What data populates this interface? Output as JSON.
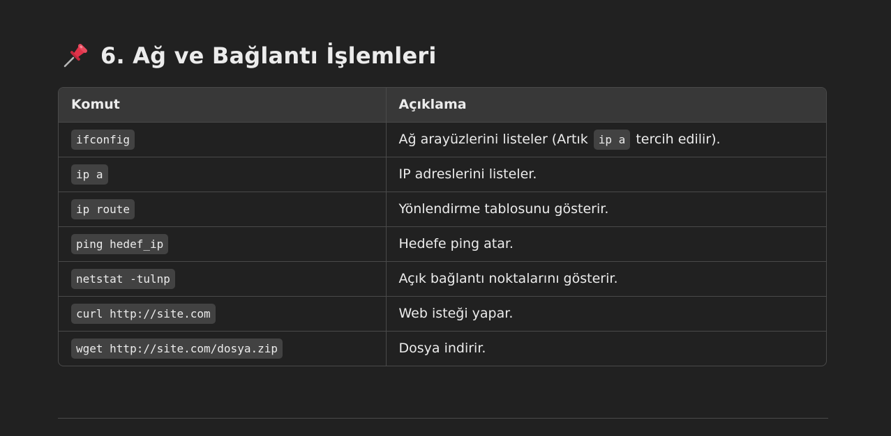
{
  "heading": {
    "icon": "pushpin-icon",
    "title": "6. Ağ ve Bağlantı İşlemleri"
  },
  "table": {
    "headers": [
      "Komut",
      "Açıklama"
    ],
    "rows": [
      {
        "command": "ifconfig",
        "description_before": "Ağ arayüzlerini listeler (Artık ",
        "description_code": "ip a",
        "description_after": " tercih edilir)."
      },
      {
        "command": "ip a",
        "description": "IP adreslerini listeler."
      },
      {
        "command": "ip route",
        "description": "Yönlendirme tablosunu gösterir."
      },
      {
        "command": "ping hedef_ip",
        "description": "Hedefe ping atar."
      },
      {
        "command": "netstat -tulnp",
        "description": "Açık bağlantı noktalarını gösterir."
      },
      {
        "command": "curl http://site.com",
        "description": "Web isteği yapar."
      },
      {
        "command": "wget http://site.com/dosya.zip",
        "description": "Dosya indirir."
      }
    ]
  },
  "colors": {
    "background": "#212121",
    "header_background": "#383838",
    "code_background": "#424242",
    "border": "#4a4a4a",
    "text": "#ececec",
    "pin_red": "#e0334a"
  }
}
